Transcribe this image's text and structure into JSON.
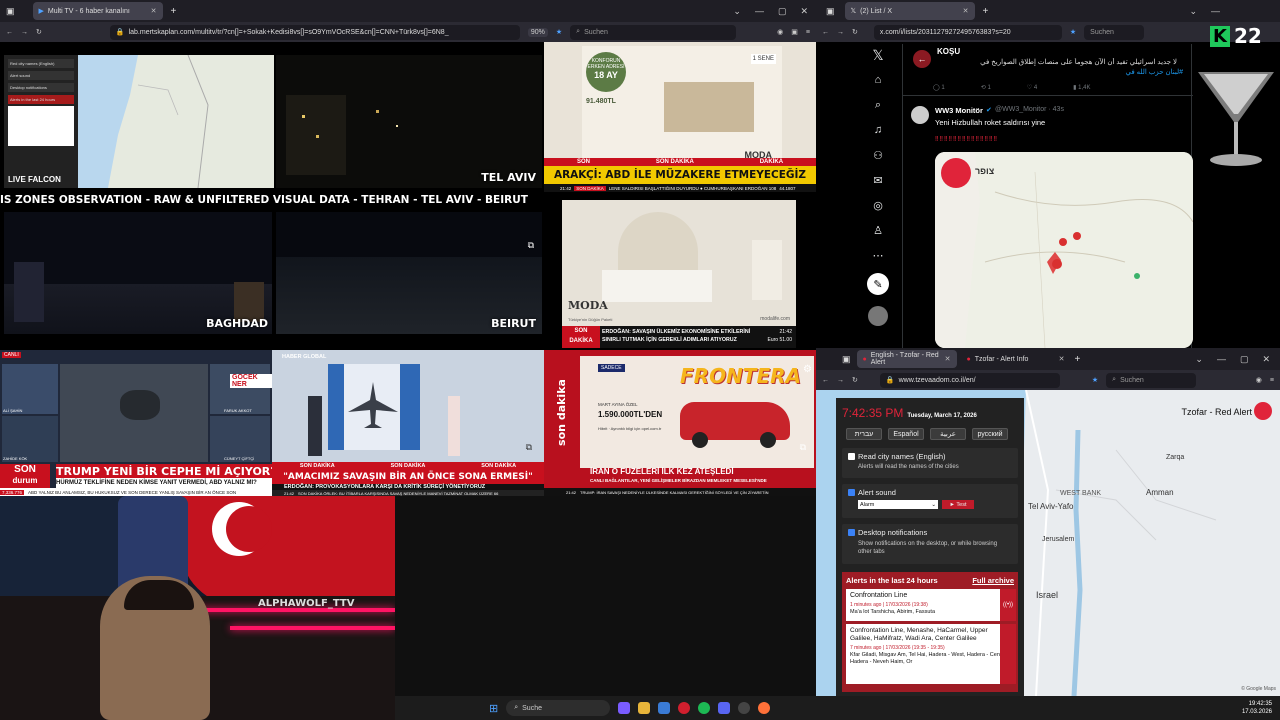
{
  "left_browser": {
    "tab_title": "Multi TV - 6 haber kanalını",
    "url": "lab.mertskaplan.com/multitv/tr/?cn[]=+Sokak+Kedisi8vs[]=sO9YmVOcRSE&cn[]=CNN+Türk8vs[]=6N8_",
    "zoom": "90%",
    "search_placeholder": "Suchen"
  },
  "multitv": {
    "map_tile": {
      "controls_label_1": "Red city names (English)",
      "controls_label_2": "Alert sound",
      "controls_label_3": "Desktop notifications",
      "small_label": "Alerts in the last 24 hours"
    },
    "cam_tel_aviv": "TEL AVIV",
    "cam_label_falcon": "LIVE FALCON",
    "cam_baghdad": "BAGHDAD",
    "cam_beirut": "BEIRUT",
    "cam_banner": "IS ZONES OBSERVATION - RAW & UNFILTERED VISUAL DATA - TEHRAN - TEL AVIV - BEIRUT",
    "ad1": {
      "line1": "KONFORUN ERKEN ADRESİ",
      "months": "18 AY",
      "price": "91.480TL",
      "badge": "1 SENE",
      "brand": "MODA",
      "brand_sub": "Life"
    },
    "arakci": {
      "son": "SON",
      "son2": "SON DAKİKA",
      "dakika": "DAKİKA",
      "headline": "ARAKÇİ: ABD İLE MÜZAKERE ETMEYECEĞİZ",
      "time": "21:42",
      "tag": "SON DAKİKA",
      "sub": "LENE SALDIRISI BAŞLATTIĞINI DUYURDU ● CUMHURBAŞKANI ERDOĞAN 108",
      "num": "44.1807"
    },
    "ad2": {
      "brand": "MODA",
      "brand_sub": "Life",
      "tag": "Türkiye'nin Düğün Paketi",
      "site": "modalife.com"
    },
    "erdogan": {
      "son": "SON",
      "dakika": "DAKİKA",
      "line1": "ERDOĞAN: SAVAŞIN ÜLKEMİZ EKONOMİSİNE ETKİLERİNİ",
      "line2": "SINIRLI TUTMAK İÇİN GEREKLİ ADIMLARI ATIYORUZ",
      "time": "21:42",
      "euro": "Euro 51.00"
    },
    "cnnturk": {
      "canli": "CANLI",
      "headline": "TRUMP YENİ BİR CEPHE Mİ AÇIYOR?",
      "sub": "HÜRMÜZ TEKLİFİNE NEDEN KİMSE YANIT VERMEDİ, ABD YALNIZ MI?",
      "son": "SON",
      "durum": "durum",
      "ticker": "ABD YALNIZ BU ANLAMSIZ, BU HUKUKSUZ VE SON DERECE YANLIŞ SAVAŞIN BİR AN ÖNCE SON",
      "num": "7,336.776",
      "name1": "ALİ ŞAHİN",
      "name2": "ZAHİDE KÖK",
      "name3": "FARUK AKKOT",
      "name4": "CÜNEYT ÇİFTÇİ",
      "badge": "GOCEK NER"
    },
    "haberglobal": {
      "brand": "HABER GLOBAL",
      "son1": "SON DAKİKA",
      "son2": "SON DAKİKA",
      "son3": "SON DAKİKA",
      "headline": "\"AMACIMIZ SAVAŞIN BİR AN ÖNCE SONA ERMESİ\"",
      "sub": "ERDOĞAN: PROVOKASYONLARA KARŞI DA KRİTİK SÜREÇİ YÖNETİYORUZ",
      "time": "21:42",
      "ticker": "SON DAKİKA ÖRLEK: BU İTİBARLA KARŞISINDA SAVAŞ NEDENİYLE MANEVİ TAZMİNAT OLMAK ÜZERE 66"
    },
    "fronteraad": {
      "brand": "SADECE",
      "title": "FRONTERA",
      "sub": "MART AYINA ÖZEL",
      "price": "1.590.000TL'DEN",
      "note": "Hibrit · Aynıntılı bilgi için opel.com.tr"
    },
    "sondakika": {
      "brand": "son dakika",
      "headline": "İRAN O FÜZELERİ İLK KEZ ATEŞLEDİ",
      "sub": "CANLI BAĞLANTILAR, YENİ GELİŞMELER BİRAZDAN MEMLEKET MESELESİ'NDE",
      "time": "21:42",
      "ticker": "TRUMP: İRAN SAVAŞI NEDENİYLE ÜLKESİNDE KALMASI GEREKTİĞİNİ SÖYLEDİ VE ÇİN ZİYARETİN"
    }
  },
  "webcam": {
    "flag_text": "",
    "wall_text": "ALPHAWOLF_TTV"
  },
  "x_browser": {
    "tab_title": "(2) List / X",
    "url": "x.com/i/lists/2031127927249576383?s=20",
    "search_placeholder": "Suchen",
    "logo": "K",
    "channel_num": "22",
    "top_post": {
      "name": "KOŞU",
      "text": "لا جديد اسرائيلي تفيد أن الآن هجوماً على منصات إطلاق الصواريخ في",
      "hashtag": "#لبنان حزب الله في",
      "replies": "1",
      "reposts": "1",
      "likes": "4",
      "views": "1,4K"
    },
    "post": {
      "name": "WW3 Monitör",
      "handle": "@WW3_Monitor · 43s",
      "text": "Yeni Hizbullah roket saldırısı yine",
      "emoji_row": "‼‼‼‼‼‼‼‼‼‼‼‼‼‼",
      "map_app": "צופר"
    }
  },
  "tzeva_browser": {
    "tab1": "English - Tzofar - Red Alert",
    "tab2": "Tzofar - Alert Info",
    "url": "www.tzevaadom.co.il/en/",
    "search_placeholder": "Suchen",
    "clock": "7:42:35 PM",
    "date": "Tuesday, March 17, 2026",
    "languages": [
      "עברית",
      "Español",
      "عربية",
      "русский"
    ],
    "brand": "Tzofar - Red Alert",
    "opt1_title": "Read city names (English)",
    "opt1_desc": "Alerts will read the names of the cities",
    "opt2_title": "Alert sound",
    "opt2_select": "Alarm",
    "opt2_test": "► Test",
    "opt3_title": "Desktop notifications",
    "opt3_desc": "Show notifications on the desktop, or while browsing other tabs",
    "alerts_header": "Alerts in the last 24 hours",
    "full_archive": "Full archive",
    "alerts": [
      {
        "title": "Confrontation Line",
        "time": "1 minutes ago | 17/03/2026 (19:38)",
        "places": "Ma'a lot Tarshicha, Abirim, Fassuta"
      },
      {
        "title": "Confrontation Line, Menashe, HaCarmel, Upper Galilee, HaMifratz, Wadi Ara, Center Galilee",
        "time": "7 minutes ago | 17/03/2026 (19:35 - 19:35)",
        "places": "Kfar Giladi, Misgav Am, Tel Hai, Hadera - West, Hadera - Center, Hadera - Neveh Haim, Or"
      }
    ],
    "map_labels": [
      "Tel Aviv-Yafo",
      "WEST BANK",
      "Amman",
      "Jerusalem",
      "Israel",
      "Zarqa"
    ],
    "map_credit": "© Google Maps"
  },
  "taskbar": {
    "search_placeholder": "Suche",
    "time": "19:42:35",
    "date": "17.03.2026"
  }
}
